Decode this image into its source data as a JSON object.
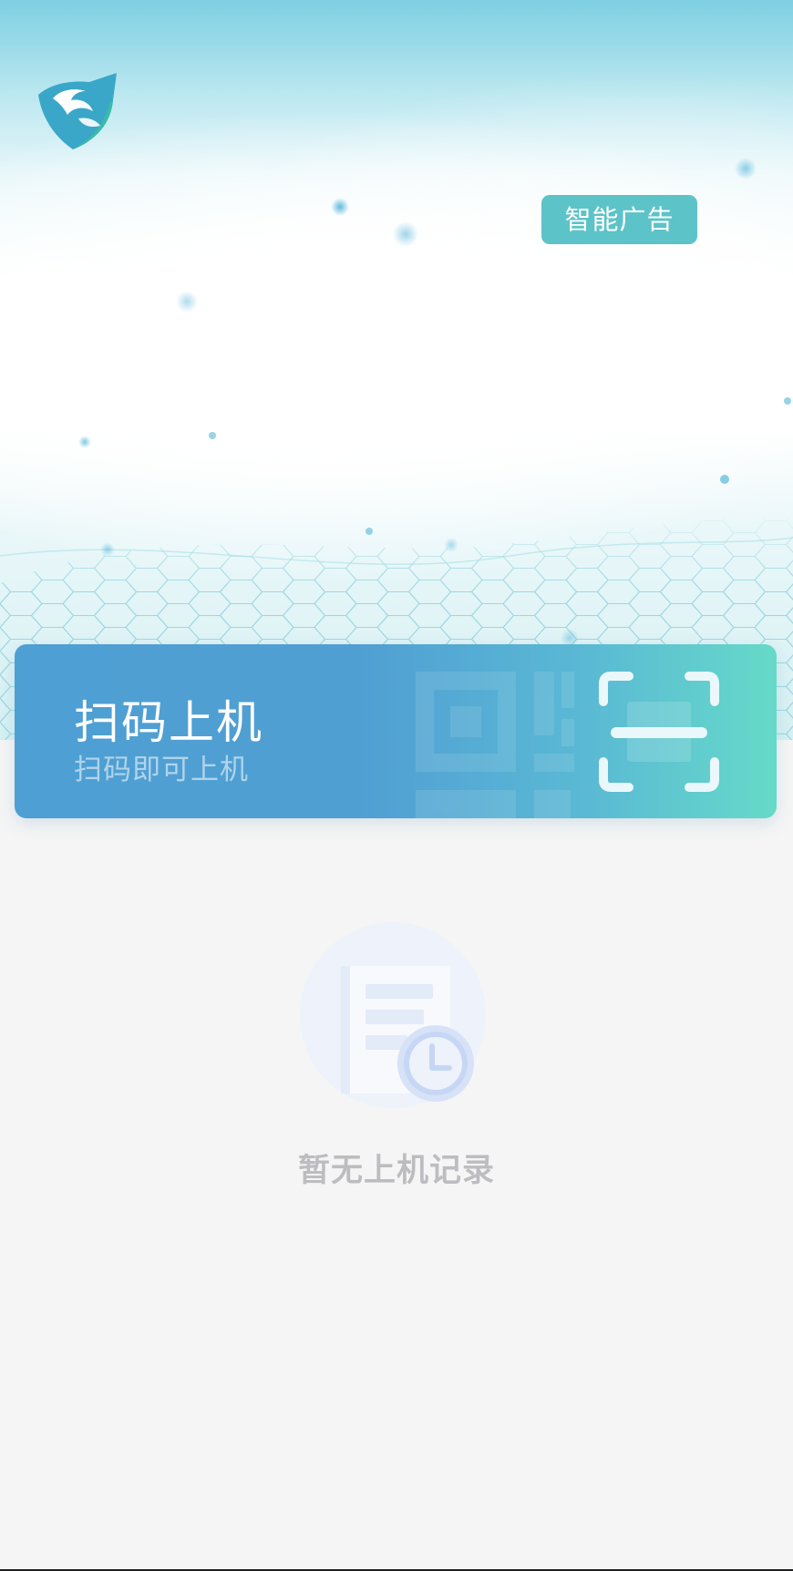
{
  "hero": {
    "logo_icon": "eagle-shield-logo-icon",
    "ad_badge_label": "智能广告"
  },
  "scan_card": {
    "title": "扫码上机",
    "subtitle": "扫码即可上机",
    "icon": "scan-frame-icon",
    "watermark_icon": "qr-code-icon"
  },
  "empty_state": {
    "icon": "document-clock-icon",
    "message": "暂无上机记录"
  },
  "colors": {
    "accent_teal": "#5cc3c8",
    "card_blue": "#4e9fd3",
    "card_green": "#66dac9",
    "empty_text": "#bdbdc1",
    "page_bg": "#f5f5f5"
  }
}
